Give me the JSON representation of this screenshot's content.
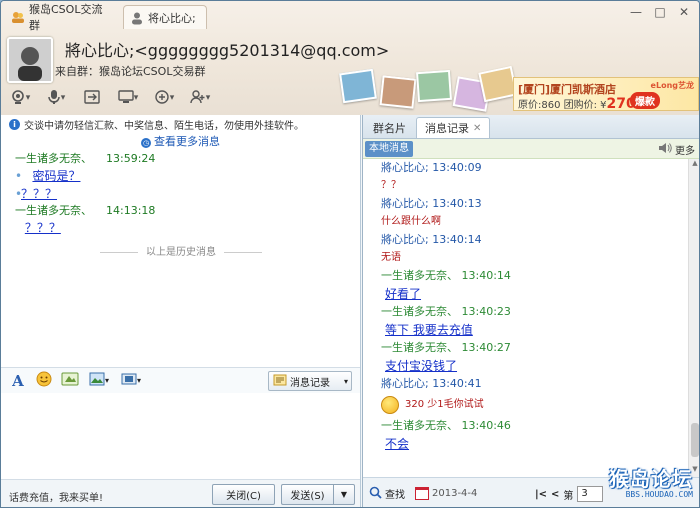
{
  "tabs": [
    {
      "label": "猴岛CSOL交流群"
    },
    {
      "label": "将心比心;"
    }
  ],
  "window_controls": {
    "minimize": "—",
    "maximize": "□",
    "close": "✕"
  },
  "contact": {
    "name": "將心比心;<gggggggg5201314@qq.com>",
    "from": "来自群：猴岛论坛CSOL交易群"
  },
  "ad": {
    "title": "[厦门]厦门凯斯酒店",
    "original_price": "原价:860 团购价: ¥",
    "price": "270",
    "badge": "爆款",
    "brand": "eLong艺龙"
  },
  "left": {
    "notice": "交谈中请勿轻信汇款、中奖信息、陌生电话，勿使用外挂软件。",
    "view_more": "查看更多消息",
    "messages": [
      {
        "sender": "一生诸多无奈、",
        "time": "13:59:24",
        "lines": [
          "密码是？",
          "？？？"
        ]
      },
      {
        "sender": "一生诸多无奈、",
        "time": "14:13:18",
        "lines": [
          "？？？"
        ]
      }
    ],
    "history_divider": "以上是历史消息",
    "history_button": "消息记录",
    "bottom_text": "话费充值，我来买单!",
    "close_button": "关闭(C)",
    "send_button": "发送(S)"
  },
  "right": {
    "tabs": [
      "群名片",
      "消息记录"
    ],
    "local_label": "本地消息",
    "more_label": "更多",
    "messages": [
      {
        "type": "sender-blue",
        "text": "將心比心; 13:40:09"
      },
      {
        "type": "content-red",
        "text": "？？"
      },
      {
        "type": "sender-blue",
        "text": "將心比心; 13:40:13"
      },
      {
        "type": "content-red",
        "text": "什么跟什么啊"
      },
      {
        "type": "sender-blue",
        "text": "將心比心; 13:40:14"
      },
      {
        "type": "content-red",
        "text": "无语"
      },
      {
        "type": "sender-green",
        "text": "一生诸多无奈、 13:40:14"
      },
      {
        "type": "content-link",
        "text": "好看了"
      },
      {
        "type": "sender-green",
        "text": "一生诸多无奈、 13:40:23"
      },
      {
        "type": "content-link",
        "text": "等下  我要去充值"
      },
      {
        "type": "sender-green",
        "text": "一生诸多无奈、 13:40:27"
      },
      {
        "type": "content-link",
        "text": "支付宝没钱了"
      },
      {
        "type": "sender-blue",
        "text": "將心比心; 13:40:41"
      },
      {
        "type": "content-emoji",
        "text": "320  少1毛你试试"
      },
      {
        "type": "sender-green",
        "text": "一生诸多无奈、 13:40:46"
      },
      {
        "type": "content-link",
        "text": "不会"
      }
    ],
    "search_label": "查找",
    "date": "2013-4-4",
    "page_prefix": "第",
    "page_value": "3"
  },
  "watermark": {
    "big": "猴岛论坛",
    "small": "BBS.HOUDAO.COM"
  },
  "colors": {
    "sender_blue": "#2458a8",
    "sender_green": "#2d8a35",
    "red_text": "#b01818",
    "link_blue": "#1530c9"
  }
}
